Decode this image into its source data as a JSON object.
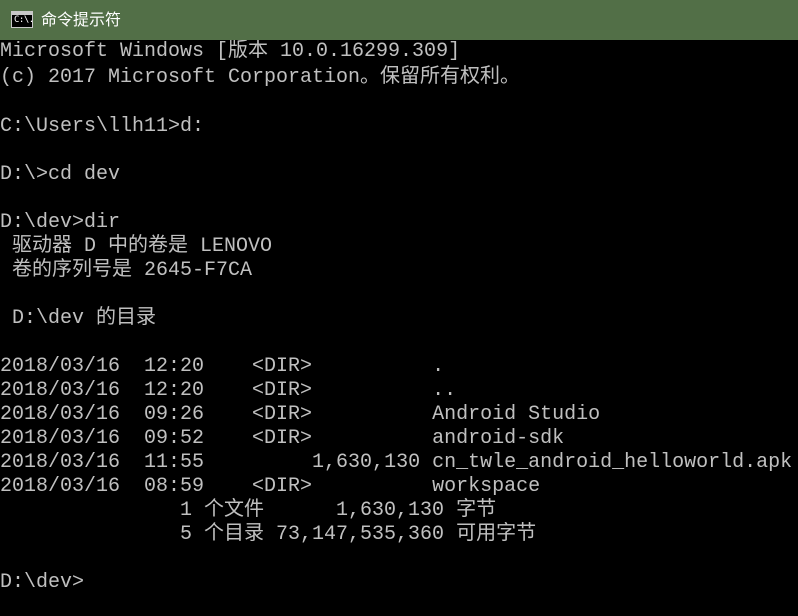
{
  "window": {
    "title": "命令提示符",
    "icon_name": "console-icon",
    "icon_glyph": "C:\\.",
    "titlebar_color": "#526f47",
    "background_color": "#000000",
    "text_color": "#c0c0c0"
  },
  "console": {
    "lines": [
      "Microsoft Windows [版本 10.0.16299.309]",
      "(c) 2017 Microsoft Corporation。保留所有权利。",
      "",
      "C:\\Users\\llh11>d:",
      "",
      "D:\\>cd dev",
      "",
      "D:\\dev>dir",
      " 驱动器 D 中的卷是 LENOVO",
      " 卷的序列号是 2645-F7CA",
      "",
      " D:\\dev 的目录",
      "",
      "2018/03/16  12:20    <DIR>          .",
      "2018/03/16  12:20    <DIR>          ..",
      "2018/03/16  09:26    <DIR>          Android Studio",
      "2018/03/16  09:52    <DIR>          android-sdk",
      "2018/03/16  11:55         1,630,130 cn_twle_android_helloworld.apk",
      "2018/03/16  08:59    <DIR>          workspace",
      "               1 个文件      1,630,130 字节",
      "               5 个目录 73,147,535,360 可用字节",
      "",
      "D:\\dev>"
    ]
  }
}
